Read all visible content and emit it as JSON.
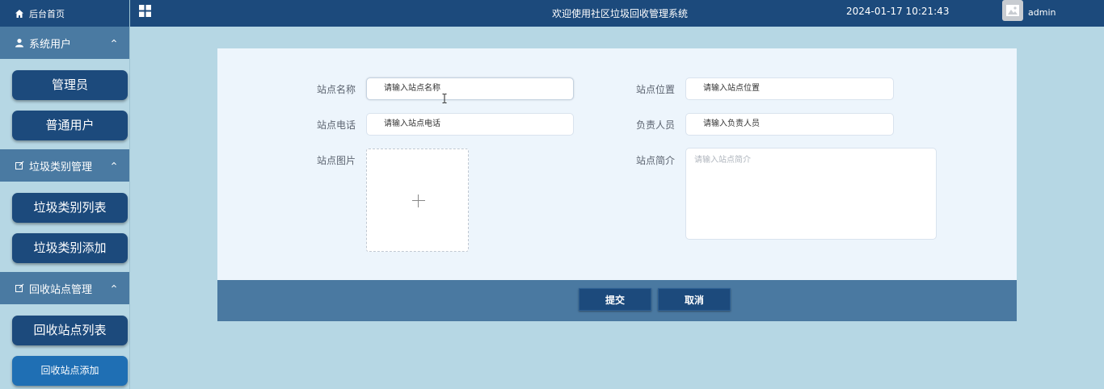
{
  "sidebar": {
    "home_label": "后台首页",
    "groups": [
      {
        "label": "系统用户",
        "items": [
          "管理员",
          "普通用户"
        ]
      },
      {
        "label": "垃圾类别管理",
        "items": [
          "垃圾类别列表",
          "垃圾类别添加"
        ]
      },
      {
        "label": "回收站点管理",
        "items": [
          "回收站点列表",
          "回收站点添加"
        ]
      }
    ]
  },
  "header": {
    "title": "欢迎使用社区垃圾回收管理系统",
    "datetime": "2024-01-17 10:21:43",
    "username": "admin"
  },
  "form": {
    "name_label": "站点名称",
    "name_value": "请输入站点名称",
    "location_label": "站点位置",
    "location_value": "请输入站点位置",
    "phone_label": "站点电话",
    "phone_value": "请输入站点电话",
    "manager_label": "负责人员",
    "manager_value": "请输入负责人员",
    "image_label": "站点图片",
    "intro_label": "站点简介",
    "intro_placeholder": "请输入站点简介"
  },
  "actions": {
    "submit_label": "提交",
    "cancel_label": "取消"
  }
}
